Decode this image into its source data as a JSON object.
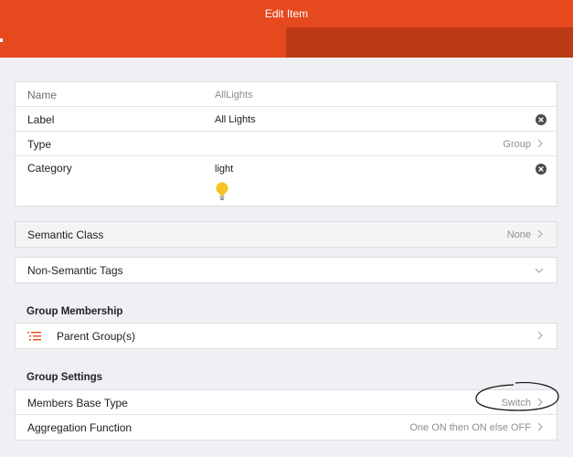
{
  "navbar": {
    "title": "Edit Item"
  },
  "item": {
    "name_label": "Name",
    "name_value": "AllLights",
    "label_label": "Label",
    "label_value": "All Lights",
    "type_label": "Type",
    "type_value": "Group",
    "category_label": "Category",
    "category_value": "light",
    "category_icon": "lightbulb-icon"
  },
  "semantic": {
    "label": "Semantic Class",
    "value": "None"
  },
  "tags": {
    "label": "Non-Semantic Tags"
  },
  "group_membership": {
    "section_title": "Group Membership",
    "parent_label": "Parent Group(s)",
    "icon": "list-icon"
  },
  "group_settings": {
    "section_title": "Group Settings",
    "base_type_label": "Members Base Type",
    "base_type_value": "Switch",
    "aggregation_label": "Aggregation Function",
    "aggregation_value": "One ON then ON else OFF"
  },
  "colors": {
    "accent": "#e6491e",
    "accent_dark": "#bb3a15",
    "bulb": "#f7c325"
  }
}
